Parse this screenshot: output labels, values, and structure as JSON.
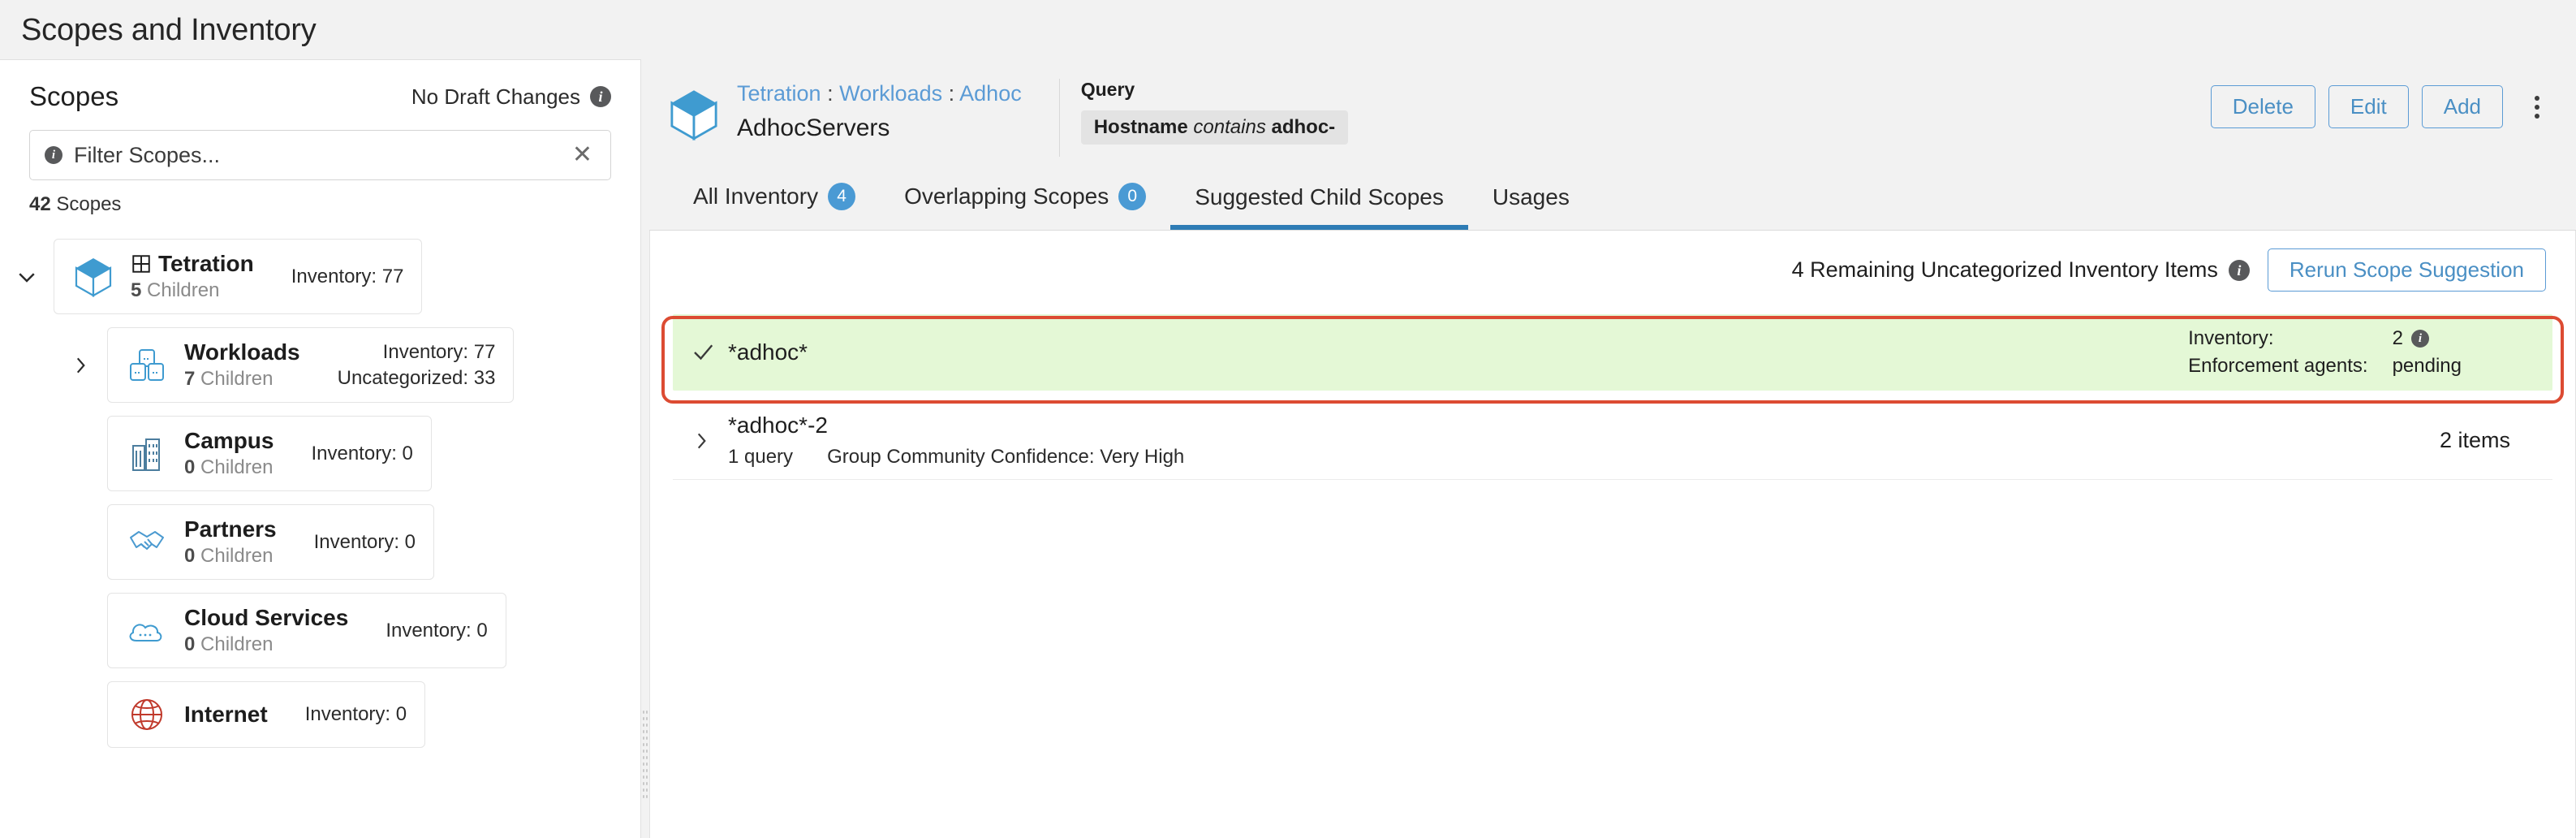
{
  "page": {
    "title": "Scopes and Inventory"
  },
  "sidebar": {
    "title": "Scopes",
    "draft_changes": "No Draft Changes",
    "filter_placeholder": "Filter Scopes...",
    "scope_count_number": "42",
    "scope_count_label": "Scopes",
    "tree": [
      {
        "name": "Tetration",
        "children_count": "5",
        "children_label": "Children",
        "icon": "cube-icon",
        "has_grid_glyph": true,
        "caret": "chevron-down-icon",
        "indent": 0,
        "stats": [
          "Inventory: 77"
        ]
      },
      {
        "name": "Workloads",
        "children_count": "7",
        "children_label": "Children",
        "icon": "workloads-icon",
        "has_grid_glyph": false,
        "caret": "chevron-right-icon",
        "indent": 1,
        "stats": [
          "Inventory: 77",
          "Uncategorized: 33"
        ]
      },
      {
        "name": "Campus",
        "children_count": "0",
        "children_label": "Children",
        "icon": "building-icon",
        "has_grid_glyph": false,
        "caret": "none",
        "indent": 1,
        "stats": [
          "Inventory: 0"
        ]
      },
      {
        "name": "Partners",
        "children_count": "0",
        "children_label": "Children",
        "icon": "handshake-icon",
        "has_grid_glyph": false,
        "caret": "none",
        "indent": 1,
        "stats": [
          "Inventory: 0"
        ]
      },
      {
        "name": "Cloud Services",
        "children_count": "0",
        "children_label": "Children",
        "icon": "cloud-icon",
        "has_grid_glyph": false,
        "caret": "none",
        "indent": 1,
        "stats": [
          "Inventory: 0"
        ]
      },
      {
        "name": "Internet",
        "children_count": "",
        "children_label": "",
        "icon": "globe-icon",
        "has_grid_glyph": false,
        "caret": "none",
        "indent": 1,
        "stats": [
          "Inventory: 0"
        ]
      }
    ]
  },
  "header": {
    "breadcrumb": [
      "Tetration",
      "Workloads",
      "Adhoc"
    ],
    "breadcrumb_separator": ":",
    "scope_name": "AdhocServers",
    "query_label": "Query",
    "query_field": "Hostname",
    "query_operator": "contains",
    "query_value": "adhoc-",
    "actions": {
      "delete": "Delete",
      "edit": "Edit",
      "add": "Add",
      "more": "kebab-menu"
    }
  },
  "tabs": [
    {
      "label": "All Inventory",
      "badge": "4",
      "active": false
    },
    {
      "label": "Overlapping Scopes",
      "badge": "0",
      "active": false
    },
    {
      "label": "Suggested Child Scopes",
      "badge": "",
      "active": true
    },
    {
      "label": "Usages",
      "badge": "",
      "active": false
    }
  ],
  "content": {
    "uncategorized_text": "4 Remaining Uncategorized Inventory Items",
    "rerun_button": "Rerun Scope Suggestion",
    "suggestions": [
      {
        "name": "*adhoc*",
        "selected": true,
        "toggle": "check-icon",
        "queries": "",
        "confidence": "",
        "inventory_label": "Inventory:",
        "inventory_value": "2",
        "agents_label": "Enforcement agents:",
        "agents_value": "pending",
        "items": ""
      },
      {
        "name": "*adhoc*-2",
        "selected": false,
        "toggle": "chevron-right-icon",
        "queries": "1 query",
        "confidence": "Group Community Confidence: Very High",
        "inventory_label": "",
        "inventory_value": "",
        "agents_label": "",
        "agents_value": "",
        "items": "2 items"
      }
    ]
  },
  "colors": {
    "accent_blue": "#4a9ad4",
    "link_blue": "#5b9bd5",
    "highlight_green": "#e4f8d6",
    "highlight_border_red": "#dc4b32",
    "internet_red": "#c0392b"
  }
}
